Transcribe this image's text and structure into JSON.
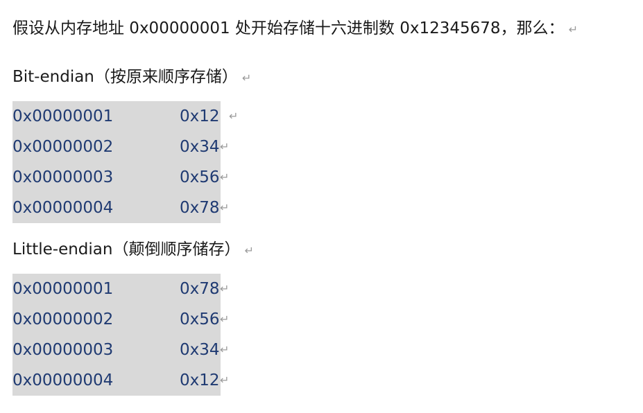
{
  "intro": {
    "text": "假设从内存地址 0x00000001 处开始存储十六进制数 0x12345678，那么："
  },
  "big_endian": {
    "heading": "Bit-endian（按原来顺序存储）",
    "rows": [
      {
        "address": "0x00000001",
        "value": "0x12"
      },
      {
        "address": "0x00000002",
        "value": "0x34"
      },
      {
        "address": "0x00000003",
        "value": "0x56"
      },
      {
        "address": "0x00000004",
        "value": "0x78"
      }
    ]
  },
  "little_endian": {
    "heading": "Little-endian（颠倒顺序储存）",
    "rows": [
      {
        "address": "0x00000001",
        "value": "0x78"
      },
      {
        "address": "0x00000002",
        "value": "0x56"
      },
      {
        "address": "0x00000003",
        "value": "0x34"
      },
      {
        "address": "0x00000004",
        "value": "0x12"
      }
    ]
  },
  "paragraph_mark": "↵"
}
